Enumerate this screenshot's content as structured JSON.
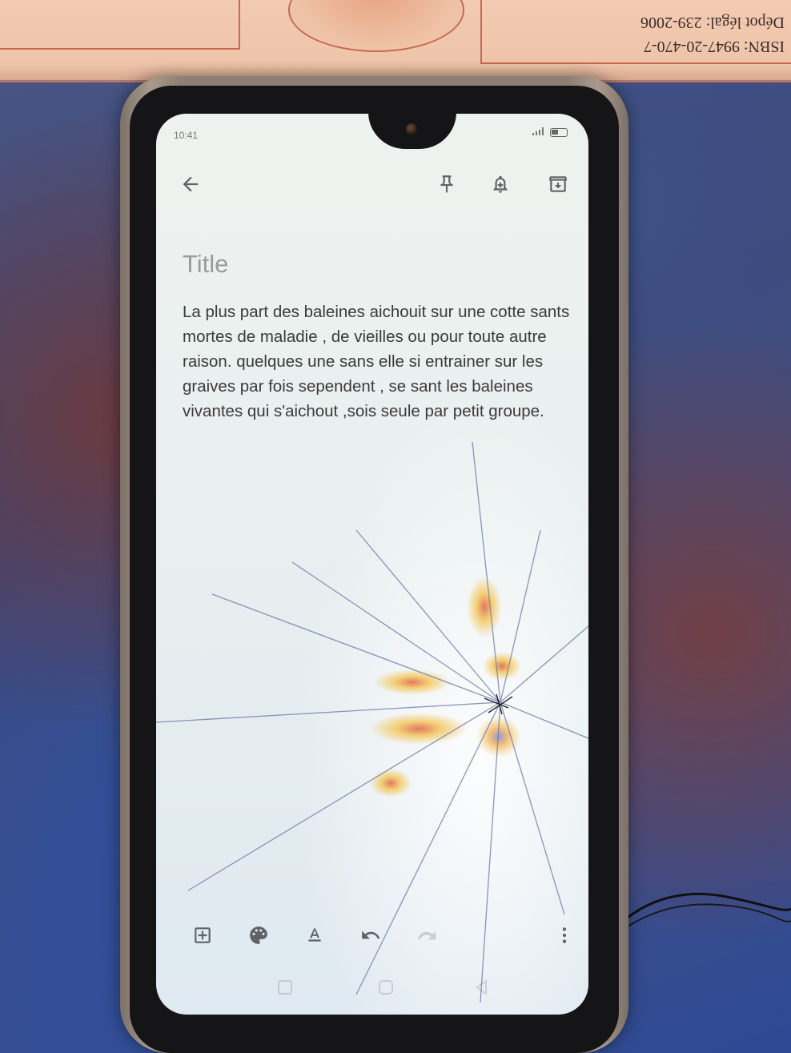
{
  "book_cover": {
    "line1": "Dépot légal: 239-2006",
    "line2": "ISBN: 9947-20-470-7"
  },
  "status_bar": {
    "time": "10:41"
  },
  "note": {
    "title_placeholder": "Title",
    "body": "La plus part des baleines aichouit sur une cotte sants mortes de maladie , de vieilles ou pour toute autre raison. quelques une sans elle si entrainer sur les graives par fois sependent , se sant les baleines vivantes qui s'aichout ,sois seule par petit groupe."
  },
  "icons": {
    "back": "arrow-left-icon",
    "pin": "pin-icon",
    "reminder": "bell-plus-icon",
    "archive": "archive-icon",
    "add": "add-box-icon",
    "palette": "palette-icon",
    "format": "text-format-icon",
    "undo": "undo-icon",
    "redo": "redo-icon",
    "more": "more-vert-icon"
  },
  "colors": {
    "screen_bg": "#e9f0ef",
    "body_text": "#3a3a3a",
    "placeholder_text": "#9a9a9a",
    "icon": "#5f6368"
  }
}
